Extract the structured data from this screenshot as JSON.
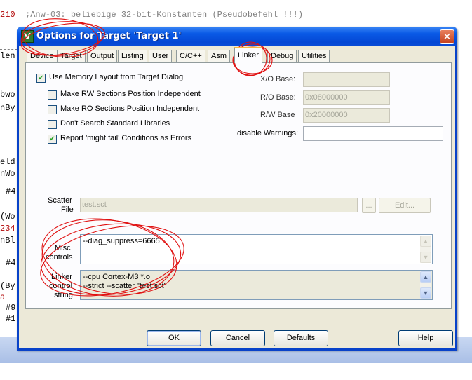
{
  "editor": {
    "line1_number": "210",
    "line1_comment": ";Anw-03: beliebige 32-bit-Konstanten (Pseudobefehl !!!)",
    "fragments": [
      {
        "text": "len",
        "cls": ""
      },
      {
        "text": "bwo",
        "cls": ""
      },
      {
        "text": "nBy",
        "cls": ""
      },
      {
        "text": "eld",
        "cls": ""
      },
      {
        "text": "nWo",
        "cls": ""
      },
      {
        "text": "#4",
        "cls": ""
      },
      {
        "text": "(Wo",
        "cls": ""
      },
      {
        "text": "234",
        "cls": "ln"
      },
      {
        "text": "nBl",
        "cls": ""
      },
      {
        "text": "#4",
        "cls": ""
      },
      {
        "text": "(By",
        "cls": ""
      },
      {
        "text": "a",
        "cls": "ln"
      },
      {
        "text": "#9",
        "cls": ""
      },
      {
        "text": "#1",
        "cls": ""
      }
    ]
  },
  "dialog": {
    "app_icon_glyph": "V",
    "title": "Options for Target 'Target 1'",
    "close_glyph": "✕",
    "tabs": [
      "Device",
      "Target",
      "Output",
      "Listing",
      "User",
      "C/C++",
      "Asm",
      "Linker",
      "Debug",
      "Utilities"
    ],
    "active_tab": "Linker",
    "linker": {
      "use_memory_layout": {
        "label": "Use Memory Layout from Target Dialog",
        "checked": true
      },
      "rw_independent": {
        "label": "Make RW Sections Position Independent",
        "checked": false
      },
      "ro_independent": {
        "label": "Make RO Sections Position Independent",
        "checked": false
      },
      "dont_search_std": {
        "label": "Don't Search Standard Libraries",
        "checked": false
      },
      "report_might_fail": {
        "label": "Report 'might fail' Conditions as Errors",
        "checked": true
      },
      "xo_base": {
        "label": "X/O Base:",
        "value": ""
      },
      "ro_base": {
        "label": "R/O Base:",
        "value": "0x08000000"
      },
      "rw_base": {
        "label": "R/W Base",
        "value": "0x20000000"
      },
      "disable_warnings": {
        "label": "disable Warnings:",
        "value": ""
      },
      "scatter_file": {
        "label_line1": "Scatter",
        "label_line2": "File",
        "value": "test.sct",
        "browse_label": "...",
        "edit_label": "Edit..."
      },
      "misc_controls": {
        "label_line1": "Misc",
        "label_line2": "controls",
        "value": "--diag_suppress=6665"
      },
      "linker_control_string": {
        "label_line1": "Linker",
        "label_line2": "control",
        "label_line3": "string",
        "line1": "--cpu Cortex-M3 *.o",
        "line2": "--strict --scatter \"test.sct\""
      }
    },
    "buttons": {
      "ok": "OK",
      "cancel": "Cancel",
      "defaults": "Defaults",
      "help": "Help"
    }
  },
  "colors": {
    "titlebar": "#0a5ae6",
    "dialog_face": "#ece9d8",
    "annotation_red": "#e01010",
    "line_number_red": "#b00000"
  }
}
